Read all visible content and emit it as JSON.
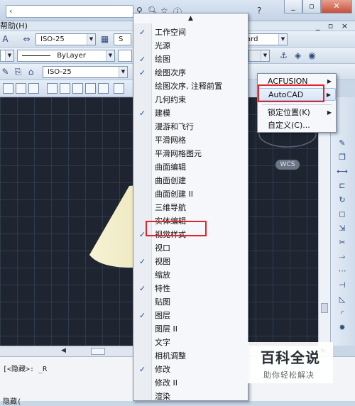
{
  "menubar": {
    "help": "帮助(H)",
    "mdi_controls": "_ ▫ ×"
  },
  "toolbar1": {
    "dimstyle": "ISO-25",
    "style2": "S",
    "style3": "ard"
  },
  "toolbar2": {
    "linetype": "ByLayer"
  },
  "toolbar3": {
    "dimstyle": "ISO-25"
  },
  "viewport": {
    "wcs_label": "WCS"
  },
  "command": {
    "line1": "[<隐藏>: _R",
    "line2": "隐藏("
  },
  "context_menu": {
    "items": [
      {
        "label": "工作空间",
        "checked": true
      },
      {
        "label": "光源",
        "checked": false
      },
      {
        "label": "绘图",
        "checked": true
      },
      {
        "label": "绘图次序",
        "checked": true
      },
      {
        "label": "绘图次序, 注释前置",
        "checked": false
      },
      {
        "label": "几何约束",
        "checked": false
      },
      {
        "label": "建模",
        "checked": true
      },
      {
        "label": "漫游和飞行",
        "checked": false
      },
      {
        "label": "平滑网格",
        "checked": false
      },
      {
        "label": "平滑网格图元",
        "checked": false
      },
      {
        "label": "曲面编辑",
        "checked": false
      },
      {
        "label": "曲面创建",
        "checked": false
      },
      {
        "label": "曲面创建 II",
        "checked": false
      },
      {
        "label": "三维导航",
        "checked": false
      },
      {
        "label": "实体编辑",
        "checked": false
      },
      {
        "label": "视觉样式",
        "checked": true
      },
      {
        "label": "视口",
        "checked": false
      },
      {
        "label": "视图",
        "checked": true
      },
      {
        "label": "缩放",
        "checked": false
      },
      {
        "label": "特性",
        "checked": true
      },
      {
        "label": "贴图",
        "checked": false
      },
      {
        "label": "图层",
        "checked": true
      },
      {
        "label": "图层 II",
        "checked": false
      },
      {
        "label": "文字",
        "checked": false
      },
      {
        "label": "相机调整",
        "checked": false
      },
      {
        "label": "修改",
        "checked": true
      },
      {
        "label": "修改 II",
        "checked": false
      },
      {
        "label": "渲染",
        "checked": false
      }
    ]
  },
  "submenu": {
    "items": [
      {
        "label": "ACFUSION",
        "has_sub": true
      },
      {
        "label": "AutoCAD",
        "has_sub": true,
        "active": true
      },
      {
        "label": "锁定位置(K)",
        "has_sub": true
      },
      {
        "label": "自定义(C)...",
        "has_sub": false
      }
    ]
  },
  "watermark": {
    "main": "百科全说",
    "sub": "助你轻松解决"
  },
  "colors": {
    "highlight_border": "#e0242a",
    "viewport_bg": "#1f2530",
    "cone": "#f2efcf"
  }
}
